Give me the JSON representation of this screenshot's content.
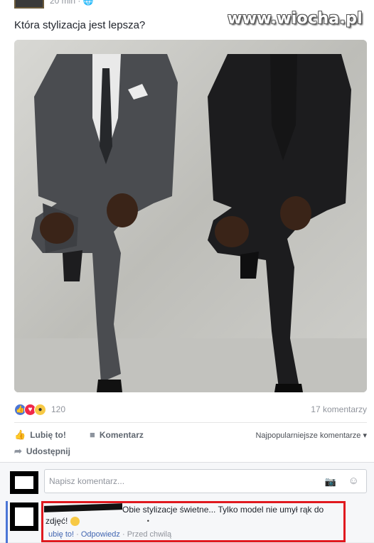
{
  "post": {
    "timestamp": "20 min · 🌐",
    "watermark": "www.wiocha.pl",
    "text": "Która stylizacja jest lepsza?"
  },
  "reactions": {
    "count": "120",
    "comments_count": "17 komentarzy",
    "colors": {
      "like": "#4b76d6",
      "love": "#f0284a",
      "wow": "#f7c945"
    }
  },
  "actions": {
    "like_label": "Lubię to!",
    "comment_label": "Komentarz",
    "share_label": "Udostępnij",
    "sort_label": "Najpopularniejsze komentarze ▾"
  },
  "composer": {
    "placeholder": "Napisz komentarz..."
  },
  "comment": {
    "text": "Obie stylizacje świetne... Tylko model nie umył rąk do zdjęć!",
    "emoji": "😐",
    "like_link": "ubię to!",
    "sep1": " · ",
    "reply_link": "Odpowiedz",
    "sep2": " · ",
    "time": "Przed chwilą",
    "highlight_color": "#e0191f"
  }
}
